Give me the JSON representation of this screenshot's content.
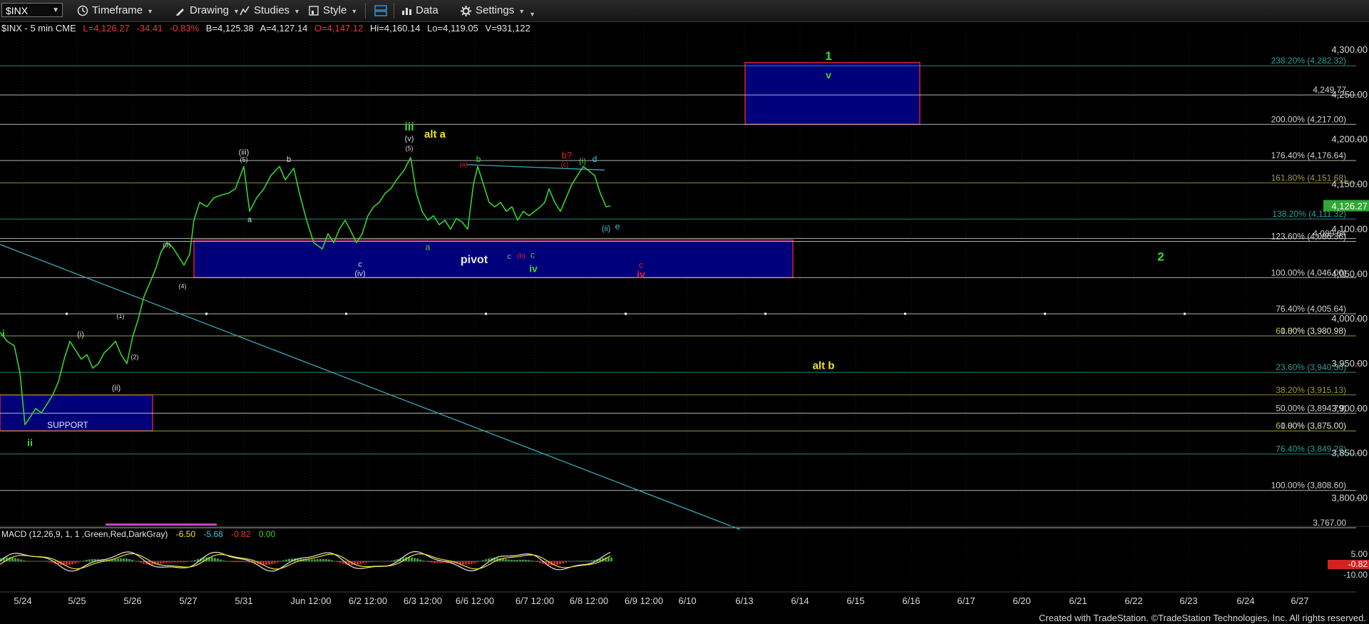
{
  "toolbar": {
    "symbol": "$INX",
    "timeframe_label": "Timeframe",
    "drawing_label": "Drawing",
    "studies_label": "Studies",
    "style_label": "Style",
    "data_label": "Data",
    "settings_label": "Settings"
  },
  "colors": {
    "background": "#000000",
    "price_line": "#35d42e",
    "box_fill": "#00007a",
    "box_border": "#d42222",
    "trend_line": "#3aa7b8",
    "green_label": "#39d833",
    "yellow_label": "#f2e226",
    "red_label": "#e82424",
    "cyan_label": "#40c8e0",
    "white_label": "#d8d8d8"
  },
  "chart_data": {
    "type": "line",
    "header": {
      "symbol_info": "$INX - 5 min  CME",
      "last": "L=4,126.27",
      "change": "-34.41",
      "pct": "-0.83%",
      "bid": "B=4,125.38",
      "ask": "A=4,127.14",
      "open": "O=4,147.12",
      "high": "Hi=4,160.14",
      "low": "Lo=4,119.05",
      "volume": "V=931,122"
    },
    "x_ticks": [
      "5/24",
      "5/25",
      "5/26",
      "5/27",
      "5/31",
      "Jun 12:00",
      "6/2 12:00",
      "6/3 12:00",
      "6/6 12:00",
      "6/7 12:00",
      "6/8 12:00",
      "6/9 12:00",
      "6/10",
      "6/13",
      "6/14",
      "6/15",
      "6/16",
      "6/17",
      "6/20",
      "6/21",
      "6/22",
      "6/23",
      "6/24",
      "6/27"
    ],
    "y_ticks": [
      "4,300.00",
      "4,250.00",
      "4,200.00",
      "4,150.00",
      "4,100.00",
      "4,050.00",
      "4,000.00",
      "3,950.00",
      "3,900.00",
      "3,850.00",
      "3,800.00"
    ],
    "ylim": [
      3767,
      4320
    ],
    "last_price_label": "4,126.27",
    "price_series": [
      {
        "t": 0,
        "p": 3985
      },
      {
        "t": 10,
        "p": 3975
      },
      {
        "t": 20,
        "p": 3970
      },
      {
        "t": 28,
        "p": 3940
      },
      {
        "t": 35,
        "p": 3882
      },
      {
        "t": 42,
        "p": 3890
      },
      {
        "t": 50,
        "p": 3900
      },
      {
        "t": 58,
        "p": 3895
      },
      {
        "t": 66,
        "p": 3905
      },
      {
        "t": 74,
        "p": 3915
      },
      {
        "t": 82,
        "p": 3930
      },
      {
        "t": 90,
        "p": 3955
      },
      {
        "t": 98,
        "p": 3975
      },
      {
        "t": 106,
        "p": 3965
      },
      {
        "t": 114,
        "p": 3955
      },
      {
        "t": 122,
        "p": 3960
      },
      {
        "t": 130,
        "p": 3945
      },
      {
        "t": 138,
        "p": 3950
      },
      {
        "t": 146,
        "p": 3962
      },
      {
        "t": 154,
        "p": 3968
      },
      {
        "t": 162,
        "p": 3975
      },
      {
        "t": 170,
        "p": 3960
      },
      {
        "t": 178,
        "p": 3950
      },
      {
        "t": 186,
        "p": 3980
      },
      {
        "t": 194,
        "p": 4000
      },
      {
        "t": 202,
        "p": 4025
      },
      {
        "t": 210,
        "p": 4040
      },
      {
        "t": 218,
        "p": 4055
      },
      {
        "t": 226,
        "p": 4075
      },
      {
        "t": 234,
        "p": 4085
      },
      {
        "t": 242,
        "p": 4080
      },
      {
        "t": 250,
        "p": 4070
      },
      {
        "t": 258,
        "p": 4060
      },
      {
        "t": 266,
        "p": 4072
      },
      {
        "t": 272,
        "p": 4110
      },
      {
        "t": 280,
        "p": 4130
      },
      {
        "t": 290,
        "p": 4125
      },
      {
        "t": 300,
        "p": 4135
      },
      {
        "t": 310,
        "p": 4138
      },
      {
        "t": 320,
        "p": 4140
      },
      {
        "t": 330,
        "p": 4145
      },
      {
        "t": 342,
        "p": 4170
      },
      {
        "t": 350,
        "p": 4120
      },
      {
        "t": 360,
        "p": 4135
      },
      {
        "t": 370,
        "p": 4145
      },
      {
        "t": 380,
        "p": 4160
      },
      {
        "t": 392,
        "p": 4170
      },
      {
        "t": 400,
        "p": 4155
      },
      {
        "t": 412,
        "p": 4168
      },
      {
        "t": 420,
        "p": 4140
      },
      {
        "t": 430,
        "p": 4110
      },
      {
        "t": 440,
        "p": 4085
      },
      {
        "t": 452,
        "p": 4078
      },
      {
        "t": 460,
        "p": 4095
      },
      {
        "t": 468,
        "p": 4085
      },
      {
        "t": 476,
        "p": 4100
      },
      {
        "t": 484,
        "p": 4110
      },
      {
        "t": 492,
        "p": 4098
      },
      {
        "t": 500,
        "p": 4085
      },
      {
        "t": 508,
        "p": 4095
      },
      {
        "t": 516,
        "p": 4115
      },
      {
        "t": 524,
        "p": 4125
      },
      {
        "t": 532,
        "p": 4130
      },
      {
        "t": 540,
        "p": 4140
      },
      {
        "t": 548,
        "p": 4145
      },
      {
        "t": 556,
        "p": 4155
      },
      {
        "t": 566,
        "p": 4165
      },
      {
        "t": 576,
        "p": 4180
      },
      {
        "t": 584,
        "p": 4140
      },
      {
        "t": 592,
        "p": 4120
      },
      {
        "t": 600,
        "p": 4110
      },
      {
        "t": 608,
        "p": 4115
      },
      {
        "t": 616,
        "p": 4105
      },
      {
        "t": 624,
        "p": 4110
      },
      {
        "t": 632,
        "p": 4100
      },
      {
        "t": 640,
        "p": 4112
      },
      {
        "t": 648,
        "p": 4108
      },
      {
        "t": 656,
        "p": 4100
      },
      {
        "t": 664,
        "p": 4150
      },
      {
        "t": 670,
        "p": 4170
      },
      {
        "t": 678,
        "p": 4150
      },
      {
        "t": 686,
        "p": 4130
      },
      {
        "t": 694,
        "p": 4125
      },
      {
        "t": 702,
        "p": 4130
      },
      {
        "t": 710,
        "p": 4120
      },
      {
        "t": 718,
        "p": 4125
      },
      {
        "t": 726,
        "p": 4110
      },
      {
        "t": 734,
        "p": 4120
      },
      {
        "t": 742,
        "p": 4115
      },
      {
        "t": 750,
        "p": 4120
      },
      {
        "t": 758,
        "p": 4125
      },
      {
        "t": 764,
        "p": 4130
      },
      {
        "t": 770,
        "p": 4145
      },
      {
        "t": 778,
        "p": 4130
      },
      {
        "t": 786,
        "p": 4120
      },
      {
        "t": 794,
        "p": 4135
      },
      {
        "t": 802,
        "p": 4150
      },
      {
        "t": 810,
        "p": 4160
      },
      {
        "t": 818,
        "p": 4170
      },
      {
        "t": 826,
        "p": 4165
      },
      {
        "t": 834,
        "p": 4160
      },
      {
        "t": 842,
        "p": 4140
      },
      {
        "t": 850,
        "p": 4125
      },
      {
        "t": 856,
        "p": 4126
      }
    ],
    "horizontal_levels": [
      {
        "label": "238.20% (4,282.32)",
        "price": 4282.32,
        "color": "#2f9e96"
      },
      {
        "label": "4,249.77",
        "price": 4249.77,
        "color": "#d0d0d0"
      },
      {
        "label": "200.00% (4,217.00)",
        "price": 4217.0,
        "color": "#d0d0d0"
      },
      {
        "label": "176.40% (4,176.64)",
        "price": 4176.64,
        "color": "#d0d0d0"
      },
      {
        "label": "161.80% (4,151.68)",
        "price": 4151.68,
        "color": "#9c9c3c"
      },
      {
        "label": "138.20% (4,111.32)",
        "price": 4111.32,
        "color": "#2f9e96"
      },
      {
        "label": "4,089.64",
        "price": 4089.64,
        "color": "#d0d0d0"
      },
      {
        "label": "123.60% (4,086.36)",
        "price": 4086.36,
        "color": "#d0d0d0"
      },
      {
        "label": "100.00% (4,046.00)",
        "price": 4046.0,
        "color": "#d0d0d0"
      },
      {
        "label": "76.40% (4,005.64)",
        "price": 4005.64,
        "color": "#d0d0d0"
      },
      {
        "label": "61.80% (3,980.98)",
        "price": 3980.98,
        "color": "#b9b94a"
      },
      {
        "label": "0.00% (3,980.98)",
        "price": 3980.98,
        "color": "#d0d0d0"
      },
      {
        "label": "23.60% (3,940.30)",
        "price": 3940.3,
        "color": "#2f9e96"
      },
      {
        "label": "38.20% (3,915.13)",
        "price": 3915.13,
        "color": "#9c9c3c"
      },
      {
        "label": "50.00% (3,894.79)",
        "price": 3894.79,
        "color": "#d0d0d0"
      },
      {
        "label": "61.80% (3,875.00)",
        "price": 3875.0,
        "color": "#b9b94a"
      },
      {
        "label": "0.00% (3,875.00)",
        "price": 3875.0,
        "color": "#d0d0d0"
      },
      {
        "label": "76.40% (3,849.28)",
        "price": 3849.28,
        "color": "#2f9e96"
      },
      {
        "label": "100.00% (3,808.60)",
        "price": 3808.6,
        "color": "#d0d0d0"
      },
      {
        "label": "3,767.00",
        "price": 3767.0,
        "color": "#d0d0d0"
      }
    ],
    "boxes": [
      {
        "name": "target-box",
        "t0": 1045,
        "t1": 1290,
        "p0": 4217,
        "p1": 4286,
        "label": ""
      },
      {
        "name": "pivot-box",
        "t0": 272,
        "t1": 1112,
        "p0": 4046,
        "p1": 4088,
        "label": "pivot"
      },
      {
        "name": "support-box",
        "t0": 0,
        "t1": 214,
        "p0": 3875,
        "p1": 3915,
        "label": "SUPPORT"
      }
    ],
    "wave_labels": [
      {
        "text": "1",
        "t": 1162,
        "p": 4289,
        "color": "green",
        "size": 17
      },
      {
        "text": "v",
        "t": 1162,
        "p": 4268,
        "color": "green",
        "size": 14
      },
      {
        "text": "2",
        "t": 1628,
        "p": 4065,
        "color": "green",
        "size": 17
      },
      {
        "text": "alt b",
        "t": 1155,
        "p": 3944,
        "color": "yellow",
        "size": 15
      },
      {
        "text": "iii",
        "t": 574,
        "p": 4210,
        "color": "green",
        "size": 16
      },
      {
        "text": "(v)",
        "t": 574,
        "p": 4198,
        "color": "white",
        "size": 11
      },
      {
        "text": "(5)",
        "t": 574,
        "p": 4188,
        "color": "white",
        "size": 9
      },
      {
        "text": "alt a",
        "t": 610,
        "p": 4202,
        "color": "yellow",
        "size": 15
      },
      {
        "text": "(iii)",
        "t": 342,
        "p": 4183,
        "color": "white",
        "size": 11
      },
      {
        "text": "(5)",
        "t": 342,
        "p": 4175,
        "color": "white",
        "size": 9
      },
      {
        "text": "b",
        "t": 405,
        "p": 4175,
        "color": "white",
        "size": 11
      },
      {
        "text": "a",
        "t": 350,
        "p": 4108,
        "color": "white",
        "size": 11
      },
      {
        "text": "c",
        "t": 505,
        "p": 4058,
        "color": "white",
        "size": 11
      },
      {
        "text": "(iv)",
        "t": 505,
        "p": 4048,
        "color": "white",
        "size": 11
      },
      {
        "text": "(3)",
        "t": 234,
        "p": 4080,
        "color": "white",
        "size": 9
      },
      {
        "text": "(4)",
        "t": 256,
        "p": 4034,
        "color": "white",
        "size": 9
      },
      {
        "text": "(1)",
        "t": 169,
        "p": 4001,
        "color": "white",
        "size": 9
      },
      {
        "text": "(2)",
        "t": 189,
        "p": 3955,
        "color": "white",
        "size": 9
      },
      {
        "text": "(i)",
        "t": 113,
        "p": 3980,
        "color": "white",
        "size": 11
      },
      {
        "text": "(ii)",
        "t": 163,
        "p": 3920,
        "color": "white",
        "size": 11
      },
      {
        "text": "i",
        "t": 5,
        "p": 3980,
        "color": "green",
        "size": 14
      },
      {
        "text": "ii",
        "t": 42,
        "p": 3858,
        "color": "green",
        "size": 14
      },
      {
        "text": "b",
        "t": 671,
        "p": 4175,
        "color": "green",
        "size": 12
      },
      {
        "text": "(a)",
        "t": 650,
        "p": 4170,
        "color": "red",
        "size": 9
      },
      {
        "text": "a",
        "t": 600,
        "p": 4077,
        "color": "green",
        "size": 12
      },
      {
        "text": "c",
        "t": 714,
        "p": 4067,
        "color": "cyan",
        "size": 11
      },
      {
        "text": "(b)",
        "t": 731,
        "p": 4068,
        "color": "red",
        "size": 9
      },
      {
        "text": "c",
        "t": 747,
        "p": 4068,
        "color": "green",
        "size": 12
      },
      {
        "text": "iv",
        "t": 748,
        "p": 4052,
        "color": "green",
        "size": 14
      },
      {
        "text": "b?",
        "t": 795,
        "p": 4179,
        "color": "red",
        "size": 13
      },
      {
        "text": "(c)",
        "t": 792,
        "p": 4170,
        "color": "red",
        "size": 9
      },
      {
        "text": "(i)",
        "t": 817,
        "p": 4173,
        "color": "green",
        "size": 11
      },
      {
        "text": "d",
        "t": 834,
        "p": 4175,
        "color": "cyan",
        "size": 12
      },
      {
        "text": "(ii)",
        "t": 850,
        "p": 4098,
        "color": "cyan",
        "size": 11
      },
      {
        "text": "e",
        "t": 866,
        "p": 4100,
        "color": "cyan",
        "size": 12
      },
      {
        "text": "c",
        "t": 899,
        "p": 4057,
        "color": "red",
        "size": 12
      },
      {
        "text": "iv",
        "t": 899,
        "p": 4046,
        "color": "red",
        "size": 14
      }
    ],
    "trend_lines": [
      {
        "t0": 0,
        "p0": 4083,
        "t1": 1038,
        "p1": 3765,
        "color": "#3aa7b8"
      },
      {
        "t0": 655,
        "p0": 4172,
        "t1": 848,
        "p1": 4166,
        "color": "#3aa7b8"
      }
    ],
    "dotted_level": {
      "price": 4005.64
    },
    "macd": {
      "label": "MACD (12,26,9, 1, 1 ,Green,Red,DarkGray)",
      "v1": "-6.50",
      "v2": "-5.68",
      "v3": "-0.82",
      "v4": "0.00",
      "y_ticks": [
        "5.00",
        "-10.00"
      ],
      "current": "-0.82"
    }
  },
  "footer": {
    "text": "Created with TradeStation. ©TradeStation Technologies, Inc. All rights reserved."
  }
}
